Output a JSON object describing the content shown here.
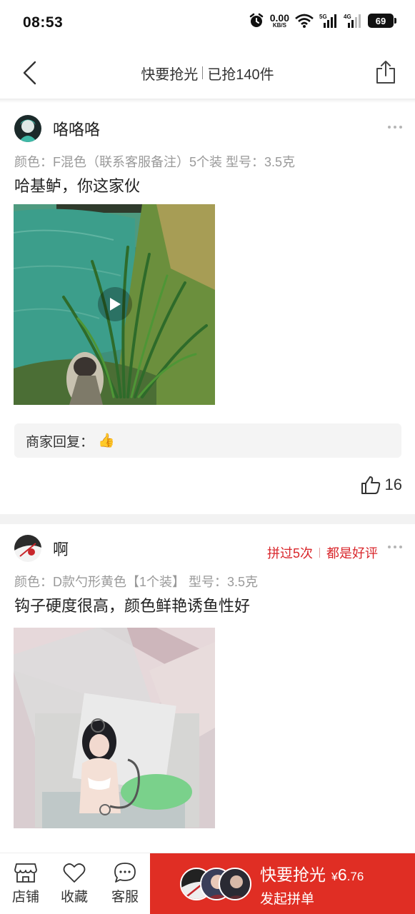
{
  "status_bar": {
    "time": "08:53",
    "net_speed_value": "0.00",
    "net_speed_unit": "KB/S",
    "signal_1": "5G",
    "signal_2": "4G",
    "battery": "69",
    "icons": [
      "alarm-icon",
      "wifi-icon",
      "signal-5g-icon",
      "signal-4g-icon",
      "battery-icon"
    ]
  },
  "header": {
    "title_left": "快要抢光",
    "title_right": "已抢140件",
    "back_icon": "chevron-left-icon",
    "share_icon": "share-icon"
  },
  "reviews": [
    {
      "username": "咯咯咯",
      "spec": "颜色：F混色（联系客服备注）5个装  型号：3.5克",
      "text": "哈基鲈，你这家伙",
      "media": "video",
      "merchant_reply_label": "商家回复：",
      "merchant_reply_emoji": "👍",
      "likes": "16"
    },
    {
      "username": "啊",
      "badge_1": "拼过5次",
      "badge_2": "都是好评",
      "spec": "颜色：D款勺形黄色【1个装】  型号：3.5克",
      "text": "钩子硬度很高，颜色鲜艳诱鱼性好",
      "media": "image"
    }
  ],
  "bottom_bar": {
    "tabs": [
      {
        "label": "店铺",
        "icon": "store-icon"
      },
      {
        "label": "收藏",
        "icon": "heart-icon"
      },
      {
        "label": "客服",
        "icon": "chat-icon"
      }
    ],
    "buy": {
      "title": "快要抢光",
      "currency": "¥",
      "price_int": "6",
      "price_dec": ".76",
      "subtitle": "发起拼单"
    }
  },
  "colors": {
    "accent_red": "#e02e24",
    "badge_red": "#d9262b",
    "muted_text": "#9a9a9a"
  }
}
